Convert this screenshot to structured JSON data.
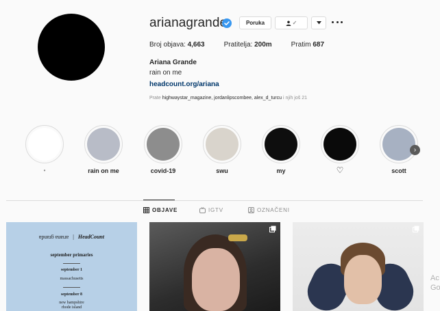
{
  "profile": {
    "username": "arianagrande",
    "verified": true,
    "message_button": "Poruka",
    "follow_check": "✓",
    "stats": {
      "posts_label": "Broj objava:",
      "posts_value": "4,663",
      "followers_label": "Pratitelja:",
      "followers_value": "200m",
      "following_label": "Pratim",
      "following_value": "687"
    },
    "full_name": "Ariana Grande",
    "bio": "rain on me",
    "link": "headcount.org/ariana",
    "followed_by_prefix": "Prate",
    "followed_by_users": "highwaystar_magazine, jordanlipscombee, alex_d_turcu",
    "followed_by_suffix": "i njih još 21"
  },
  "highlights": [
    {
      "label": "•",
      "color": "#ffffff"
    },
    {
      "label": "rain on me",
      "color": "#b8bcc7"
    },
    {
      "label": "covid-19",
      "color": "#8d8d8d"
    },
    {
      "label": "swu",
      "color": "#d9d4cc"
    },
    {
      "label": "my",
      "color": "#0e0e0e"
    },
    {
      "label": "♡",
      "color": "#0a0a0a"
    },
    {
      "label": "scott",
      "color": "#a7b1c2"
    }
  ],
  "tabs": {
    "posts": "OBJAVE",
    "igtv": "IGTV",
    "tagged": "OZNAČENI"
  },
  "posts": {
    "post1": {
      "top": "ɐpuɐɹƃ ɐuɐıɹɐ",
      "logo": "HeadCount",
      "heading": "september primaries",
      "date1": "september 1",
      "state1": "massachusetts",
      "date2": "september 8",
      "state2": "new hampshire",
      "state3": "rhode island"
    }
  },
  "watermark": {
    "line1": "Ac",
    "line2": "Go"
  },
  "colors": {
    "link": "#00376b",
    "verified": "#3897f0",
    "muted": "#8e8e8e"
  }
}
